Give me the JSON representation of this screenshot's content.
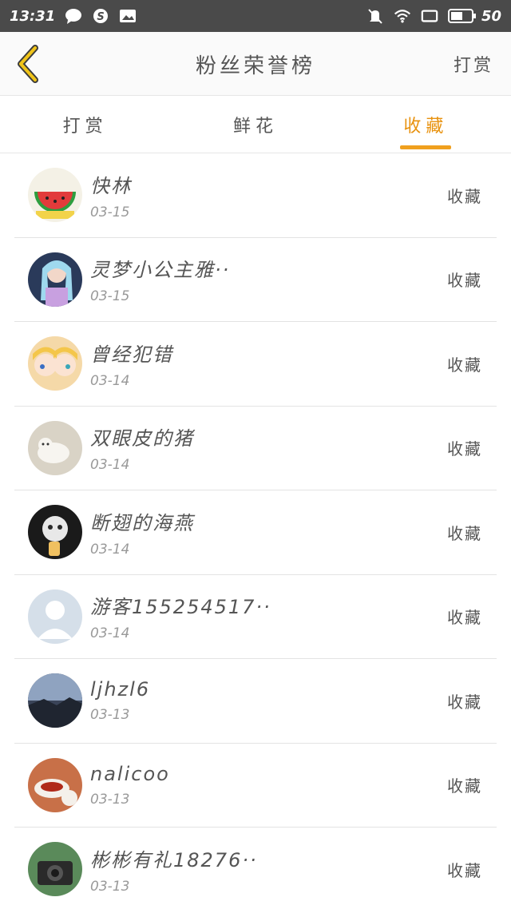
{
  "status_bar": {
    "time": "13:31",
    "battery": "50"
  },
  "header": {
    "title": "粉丝荣誉榜",
    "action_label": "打赏"
  },
  "tabs": [
    {
      "label": "打赏",
      "active": false
    },
    {
      "label": "鲜花",
      "active": false
    },
    {
      "label": "收藏",
      "active": true
    }
  ],
  "colors": {
    "accent": "#f0a01e",
    "accent_text": "#e8920f",
    "status_bar_bg": "#4a4a4a"
  },
  "fans": [
    {
      "name": "快林",
      "date": "03-15",
      "action": "收藏"
    },
    {
      "name": "灵梦小公主雅··",
      "date": "03-15",
      "action": "收藏"
    },
    {
      "name": "曾经犯错",
      "date": "03-14",
      "action": "收藏"
    },
    {
      "name": "双眼皮的猪",
      "date": "03-14",
      "action": "收藏"
    },
    {
      "name": "断翅的海燕",
      "date": "03-14",
      "action": "收藏"
    },
    {
      "name": "游客155254517··",
      "date": "03-14",
      "action": "收藏"
    },
    {
      "name": "ljhzl6",
      "date": "03-13",
      "action": "收藏"
    },
    {
      "name": "nalicoo",
      "date": "03-13",
      "action": "收藏"
    },
    {
      "name": "彬彬有礼18276··",
      "date": "03-13",
      "action": "收藏"
    }
  ]
}
